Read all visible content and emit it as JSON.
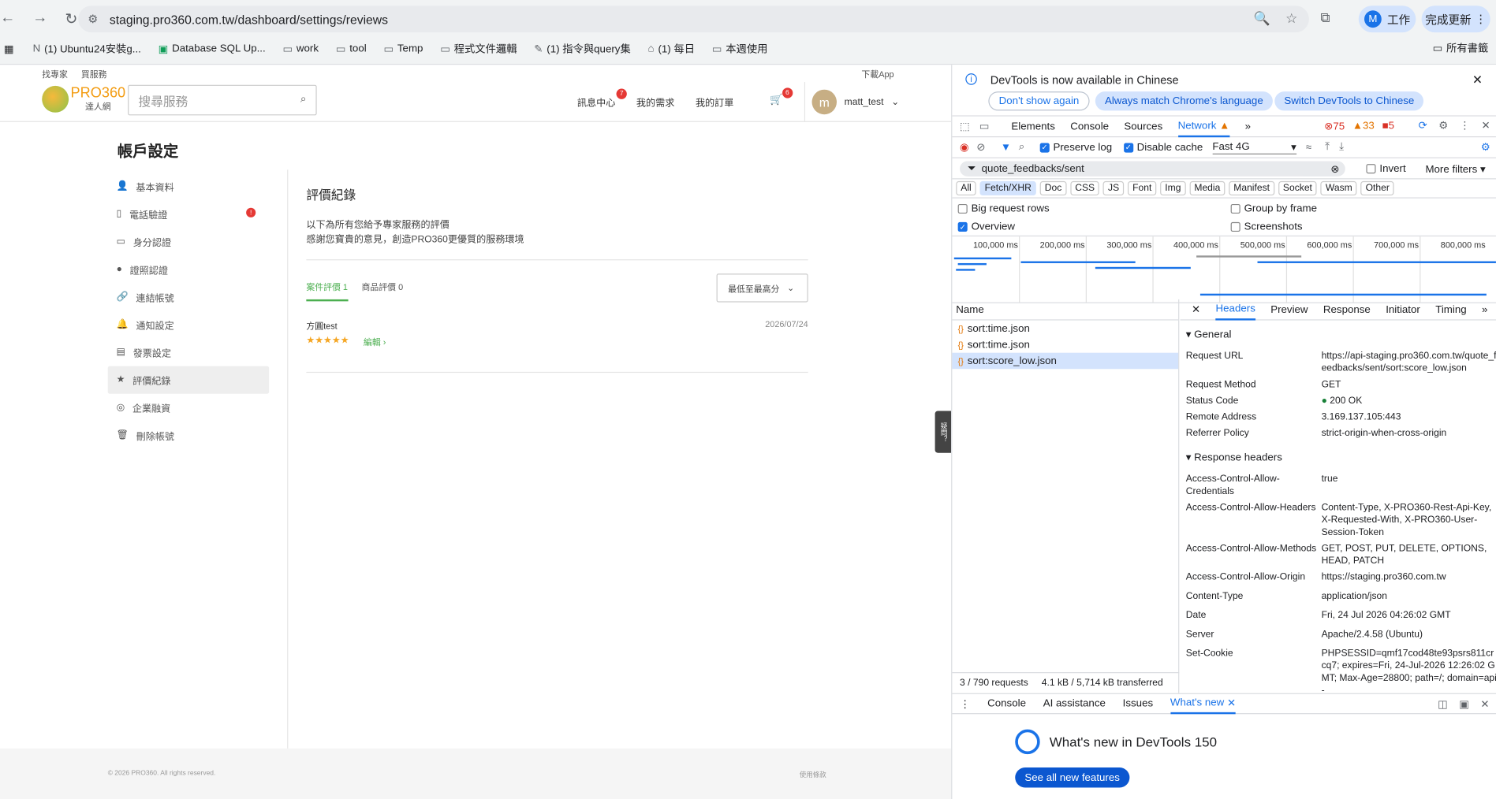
{
  "browser": {
    "url": "staging.pro360.com.tw/dashboard/settings/reviews",
    "profile_label": "工作",
    "profile_initial": "M",
    "update_label": "完成更新",
    "bookmarks": [
      "(1) Ubuntu24安裝g...",
      "Database SQL Up...",
      "work",
      "tool",
      "Temp",
      "程式文件邏輯",
      "(1) 指令與query集",
      "(1) 每日",
      "本週使用"
    ],
    "all_bookmarks": "所有書籤"
  },
  "site": {
    "top_links": [
      "找專家",
      "買服務"
    ],
    "download_app": "下載App",
    "logo_text": "PRO360",
    "logo_sub": "達人網",
    "search_placeholder": "搜尋服務",
    "nav": [
      {
        "label": "訊息中心",
        "badge": "7"
      },
      {
        "label": "我的需求",
        "badge": ""
      },
      {
        "label": "我的訂單",
        "badge": ""
      }
    ],
    "cart_badge": "6",
    "user_initial": "m",
    "username": "matt_test",
    "page_title": "帳戶設定",
    "sidebar": [
      {
        "icon": "user-icon",
        "label": "基本資料"
      },
      {
        "icon": "phone-icon",
        "label": "電話驗證",
        "alert": "!"
      },
      {
        "icon": "id-card-icon",
        "label": "身分認證"
      },
      {
        "icon": "license-icon",
        "label": "證照認證"
      },
      {
        "icon": "link-icon",
        "label": "連結帳號"
      },
      {
        "icon": "bell-icon",
        "label": "通知設定"
      },
      {
        "icon": "invoice-icon",
        "label": "發票設定"
      },
      {
        "icon": "star-icon",
        "label": "評價紀錄",
        "active": true
      },
      {
        "icon": "handshake-icon",
        "label": "企業融資"
      },
      {
        "icon": "trash-icon",
        "label": "刪除帳號"
      }
    ],
    "main": {
      "title": "評價紀錄",
      "desc1": "以下為所有您給予專家服務的評價",
      "desc2": "感謝您寶貴的意見，創造PRO360更優質的服務環境",
      "tab_case": "案件評價 1",
      "tab_product": "商品評價 0",
      "sort_label": "最低至最高分",
      "review": {
        "name": "方圓test",
        "date": "2026/07/24",
        "stars": "★★★★★",
        "edit": "編輯"
      }
    },
    "float_tab": "疑問？",
    "footer_copy": "© 2026 PRO360. All rights reserved.",
    "footer_tos": "使用條款"
  },
  "devtools": {
    "info_msg": "DevTools is now available in Chinese",
    "btn_dont_show": "Don't show again",
    "btn_match": "Always match Chrome's language",
    "btn_switch": "Switch DevTools to Chinese",
    "tabs": [
      "Elements",
      "Console",
      "Sources",
      "Network"
    ],
    "errors": "75",
    "warnings": "33",
    "issues": "5",
    "preserve_log": "Preserve log",
    "disable_cache": "Disable cache",
    "throttle": "Fast 4G",
    "filter_value": "quote_feedbacks/sent",
    "invert": "Invert",
    "more_filters": "More filters",
    "types": [
      "All",
      "Fetch/XHR",
      "Doc",
      "CSS",
      "JS",
      "Font",
      "Img",
      "Media",
      "Manifest",
      "Socket",
      "Wasm",
      "Other"
    ],
    "opt_big_rows": "Big request rows",
    "opt_group_frame": "Group by frame",
    "opt_overview": "Overview",
    "opt_screenshots": "Screenshots",
    "timeline_ticks": [
      "100,000 ms",
      "200,000 ms",
      "300,000 ms",
      "400,000 ms",
      "500,000 ms",
      "600,000 ms",
      "700,000 ms",
      "800,000 ms"
    ],
    "name_header": "Name",
    "requests": [
      "sort:time.json",
      "sort:time.json",
      "sort:score_low.json"
    ],
    "footer_requests": "3 / 790 requests",
    "footer_transfer": "4.1 kB / 5,714 kB transferred",
    "detail_tabs": [
      "Headers",
      "Preview",
      "Response",
      "Initiator",
      "Timing"
    ],
    "general_title": "General",
    "general": [
      {
        "k": "Request URL",
        "v": "https://api-staging.pro360.com.tw/quote_feedbacks/sent/sort:score_low.json"
      },
      {
        "k": "Request Method",
        "v": "GET"
      },
      {
        "k": "Status Code",
        "v": "200 OK"
      },
      {
        "k": "Remote Address",
        "v": "3.169.137.105:443"
      },
      {
        "k": "Referrer Policy",
        "v": "strict-origin-when-cross-origin"
      }
    ],
    "resp_title": "Response headers",
    "response": [
      {
        "k": "Access-Control-Allow-Credentials",
        "v": "true"
      },
      {
        "k": "Access-Control-Allow-Headers",
        "v": "Content-Type, X-PRO360-Rest-Api-Key, X-Requested-With, X-PRO360-User-Session-Token"
      },
      {
        "k": "Access-Control-Allow-Methods",
        "v": "GET, POST, PUT, DELETE, OPTIONS, HEAD, PATCH"
      },
      {
        "k": "Access-Control-Allow-Origin",
        "v": "https://staging.pro360.com.tw"
      },
      {
        "k": "Content-Type",
        "v": "application/json"
      },
      {
        "k": "Date",
        "v": "Fri, 24 Jul 2026 04:26:02 GMT"
      },
      {
        "k": "Server",
        "v": "Apache/2.4.58 (Ubuntu)"
      },
      {
        "k": "Set-Cookie",
        "v": "PHPSESSID=qmf17cod48te93psrs811crcq7; expires=Fri, 24-Jul-2026 12:26:02 GMT; Max-Age=28800; path=/; domain=api-"
      }
    ],
    "drawer_tabs": [
      "Console",
      "AI assistance",
      "Issues",
      "What's new"
    ],
    "whats_new": "What's new in DevTools 150",
    "see_all": "See all new features",
    "accent": "#1a73e8"
  }
}
